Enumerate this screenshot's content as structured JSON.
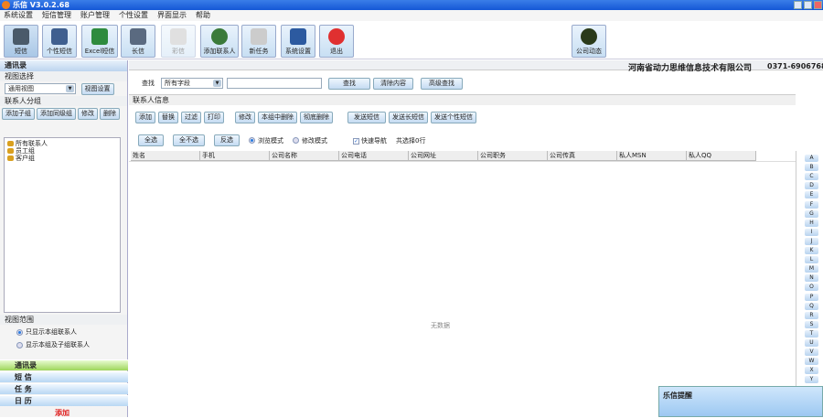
{
  "title": "乐信 V3.0.2.68",
  "menu": [
    "系统设置",
    "短信管理",
    "账户管理",
    "个性设置",
    "界面显示",
    "帮助"
  ],
  "toolbar": [
    {
      "label": "短信",
      "icon": "phone-icon"
    },
    {
      "label": "个性短信",
      "icon": "phone-person-icon"
    },
    {
      "label": "Excel短信",
      "icon": "excel-phone-icon"
    },
    {
      "label": "长信",
      "icon": "phone-doc-icon"
    },
    {
      "label": "彩信",
      "icon": "mms-icon",
      "disabled": true
    },
    {
      "label": "添加联系人",
      "icon": "add-contact-icon"
    },
    {
      "label": "新任务",
      "icon": "new-task-icon"
    },
    {
      "label": "系统设置",
      "icon": "settings-icon"
    },
    {
      "label": "退出",
      "icon": "power-icon"
    }
  ],
  "company_news": "公司动态",
  "company": "河南省动力思维信息技术有限公司",
  "phone": "0371-6906768",
  "left": {
    "header": "通讯录",
    "view_select": "视图选择",
    "view_value": "通用视图",
    "view_settings": "视图设置",
    "group_label": "联系人分组",
    "group_buttons": [
      "添加子组",
      "添加同级组",
      "修改",
      "删除"
    ],
    "tree": [
      "所有联系人",
      "员工组",
      "客户组"
    ],
    "scope_label": "视图范围",
    "scope_options": [
      "只显示本组联系人",
      "显示本组及子组联系人"
    ],
    "nav": [
      "通讯录",
      "短 信",
      "任 务",
      "日 历"
    ],
    "bottom_text": "添加"
  },
  "search": {
    "label": "查找",
    "field": "所有字段",
    "value": "",
    "find": "查找",
    "clear": "清除内容",
    "advanced": "高级查找"
  },
  "contact_info": "联系人信息",
  "actions1": [
    "添加",
    "替换",
    "过滤",
    "打印"
  ],
  "actions2": [
    "修改",
    "本组中删除",
    "彻底删除"
  ],
  "actions3": [
    "发送短信",
    "发送长短信",
    "发送个性短信"
  ],
  "select_buttons": [
    "全选",
    "全不选",
    "反选"
  ],
  "modes": [
    "浏览模式",
    "修改模式"
  ],
  "quick_nav": "快速导航",
  "selected_count": "共选择0行",
  "columns": [
    "姓名",
    "手机",
    "公司名称",
    "公司电话",
    "公司网址",
    "公司职务",
    "公司传真",
    "私人MSN",
    "私人QQ"
  ],
  "empty": "无数据",
  "letters": [
    "A",
    "B",
    "C",
    "D",
    "E",
    "F",
    "G",
    "H",
    "I",
    "J",
    "K",
    "L",
    "M",
    "N",
    "O",
    "P",
    "Q",
    "R",
    "S",
    "T",
    "U",
    "V",
    "W",
    "X",
    "Y"
  ],
  "popup_title": "乐信提醒"
}
